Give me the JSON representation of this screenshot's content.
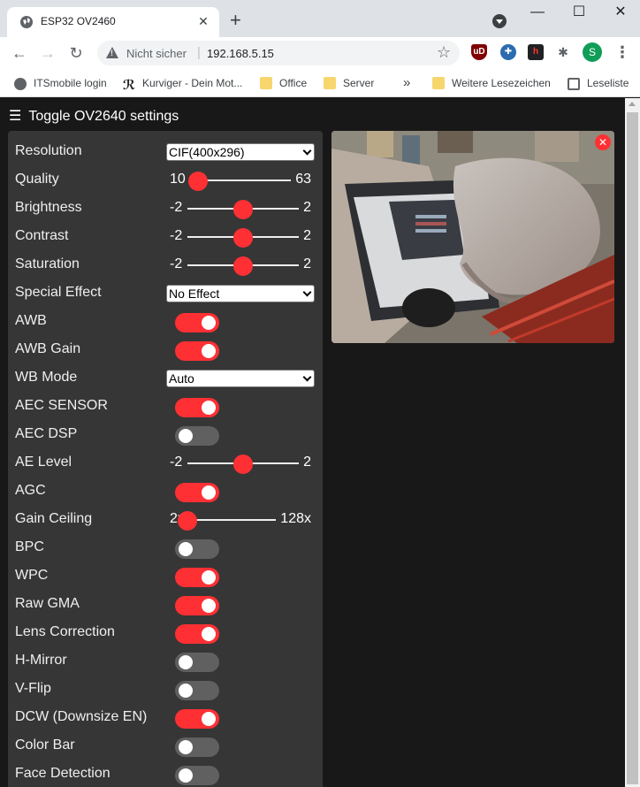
{
  "browser": {
    "tab_title": "ESP32 OV2460",
    "security_text": "Nicht sicher",
    "url": "192.168.5.15",
    "profile_initial": "S",
    "bookmarks": [
      {
        "label": "ITSmobile login",
        "icon": "gear-icon"
      },
      {
        "label": "Kurviger - Dein Mot...",
        "icon": "kurviger-logo-icon"
      },
      {
        "label": "Office",
        "icon": "folder-icon"
      },
      {
        "label": "Server",
        "icon": "folder-icon"
      },
      {
        "label": "»",
        "icon": "overflow-icon"
      },
      {
        "label": "Weitere Lesezeichen",
        "icon": "folder-icon"
      },
      {
        "label": "Leseliste",
        "icon": "reading-list-icon"
      }
    ]
  },
  "page": {
    "header": "Toggle OV2640 settings",
    "colors": {
      "accent": "#ff3034",
      "panel": "#363636",
      "background": "#181818",
      "switch_off": "#606060"
    },
    "settings": [
      {
        "label": "Resolution",
        "type": "select",
        "value": "CIF(400x296)"
      },
      {
        "label": "Quality",
        "type": "range",
        "min": "10",
        "max": "63",
        "value": 10
      },
      {
        "label": "Brightness",
        "type": "range",
        "min": "-2",
        "max": "2",
        "value": 0
      },
      {
        "label": "Contrast",
        "type": "range",
        "min": "-2",
        "max": "2",
        "value": 0
      },
      {
        "label": "Saturation",
        "type": "range",
        "min": "-2",
        "max": "2",
        "value": 0
      },
      {
        "label": "Special Effect",
        "type": "select",
        "value": "No Effect"
      },
      {
        "label": "AWB",
        "type": "switch",
        "on": true
      },
      {
        "label": "AWB Gain",
        "type": "switch",
        "on": true
      },
      {
        "label": "WB Mode",
        "type": "select",
        "value": "Auto"
      },
      {
        "label": "AEC SENSOR",
        "type": "switch",
        "on": true
      },
      {
        "label": "AEC DSP",
        "type": "switch",
        "on": false
      },
      {
        "label": "AE Level",
        "type": "range",
        "min": "-2",
        "max": "2",
        "value": 0
      },
      {
        "label": "AGC",
        "type": "switch",
        "on": true
      },
      {
        "label": "Gain Ceiling",
        "type": "range",
        "min": "2x",
        "max": "128x",
        "value": 0
      },
      {
        "label": "BPC",
        "type": "switch",
        "on": false
      },
      {
        "label": "WPC",
        "type": "switch",
        "on": true
      },
      {
        "label": "Raw GMA",
        "type": "switch",
        "on": true
      },
      {
        "label": "Lens Correction",
        "type": "switch",
        "on": true
      },
      {
        "label": "H-Mirror",
        "type": "switch",
        "on": false
      },
      {
        "label": "V-Flip",
        "type": "switch",
        "on": false
      },
      {
        "label": "DCW (Downsize EN)",
        "type": "switch",
        "on": true
      },
      {
        "label": "Color Bar",
        "type": "switch",
        "on": false
      },
      {
        "label": "Face Detection",
        "type": "switch",
        "on": false
      }
    ]
  }
}
